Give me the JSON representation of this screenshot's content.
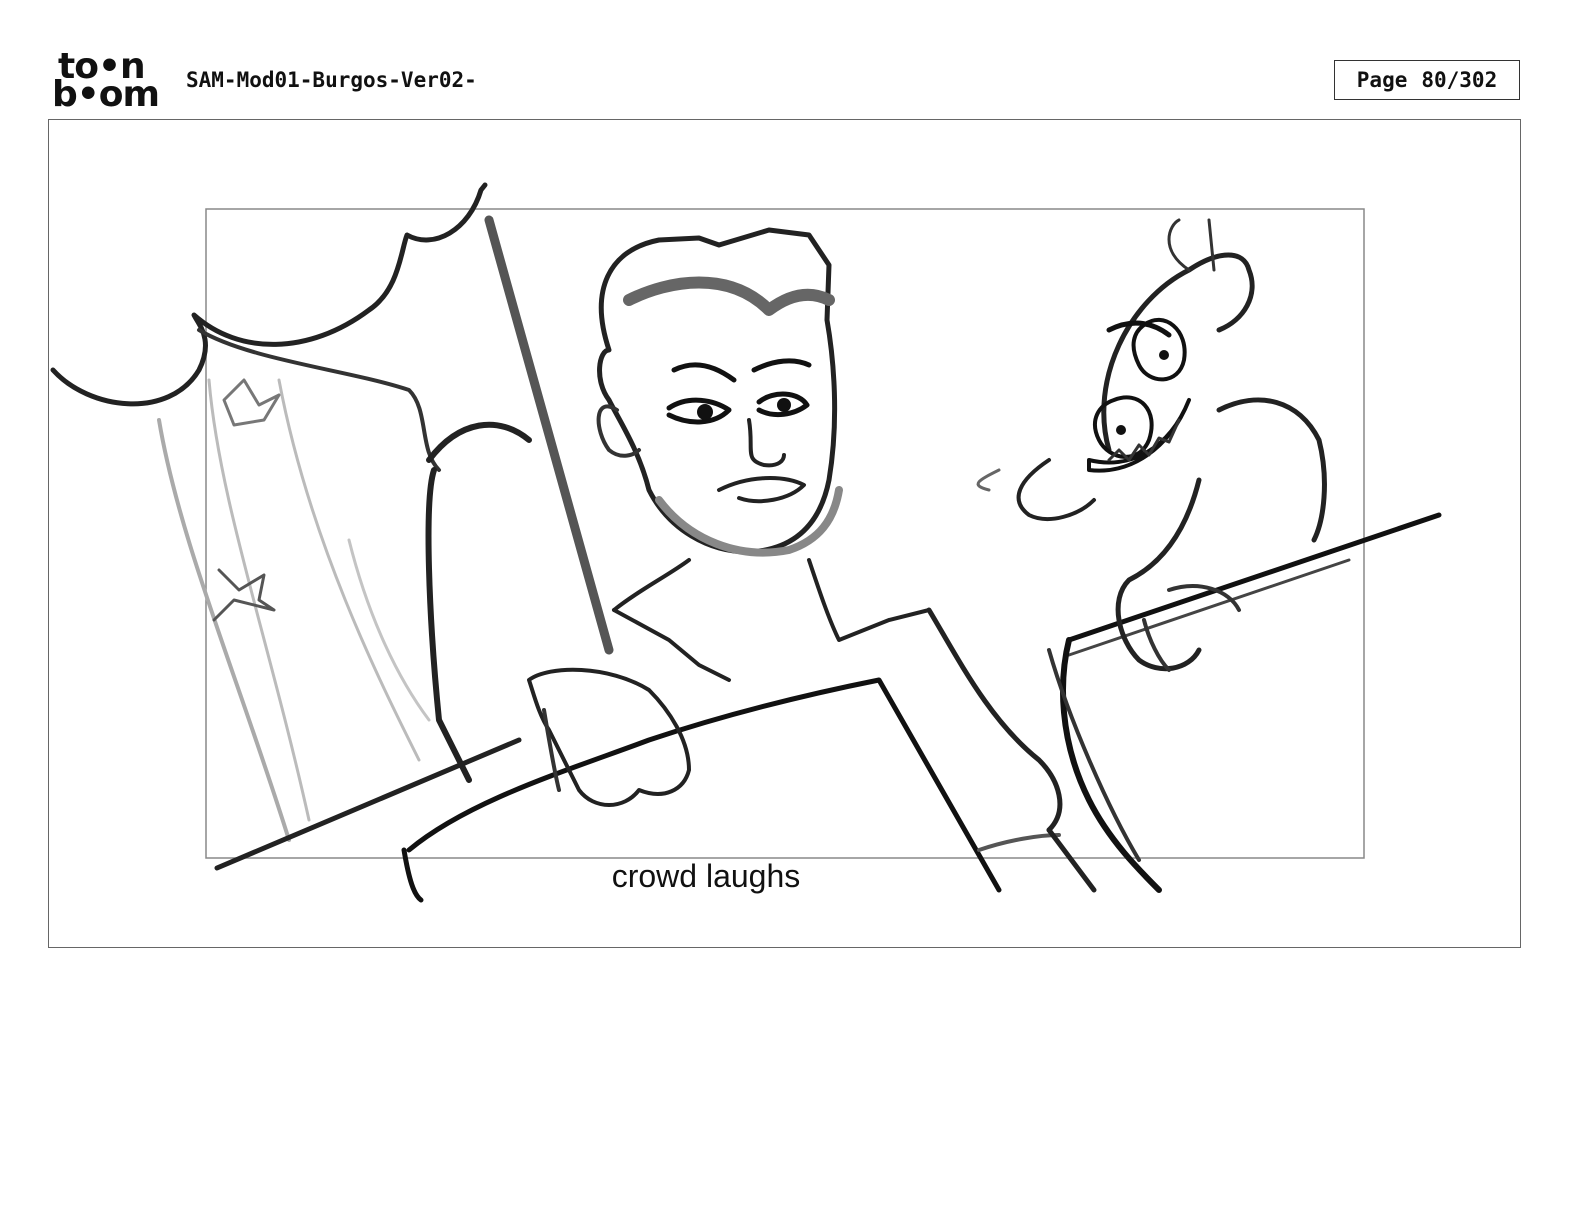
{
  "header": {
    "logo": {
      "line1": "to•n",
      "line2": "b•om",
      "icon": "toon-boom-logo"
    },
    "document_title": "SAM-Mod01-Burgos-Ver02-",
    "page_label": "Page",
    "page_number": "80/302"
  },
  "panel": {
    "caption": "crowd laughs",
    "image": "storyboard-sketch"
  }
}
